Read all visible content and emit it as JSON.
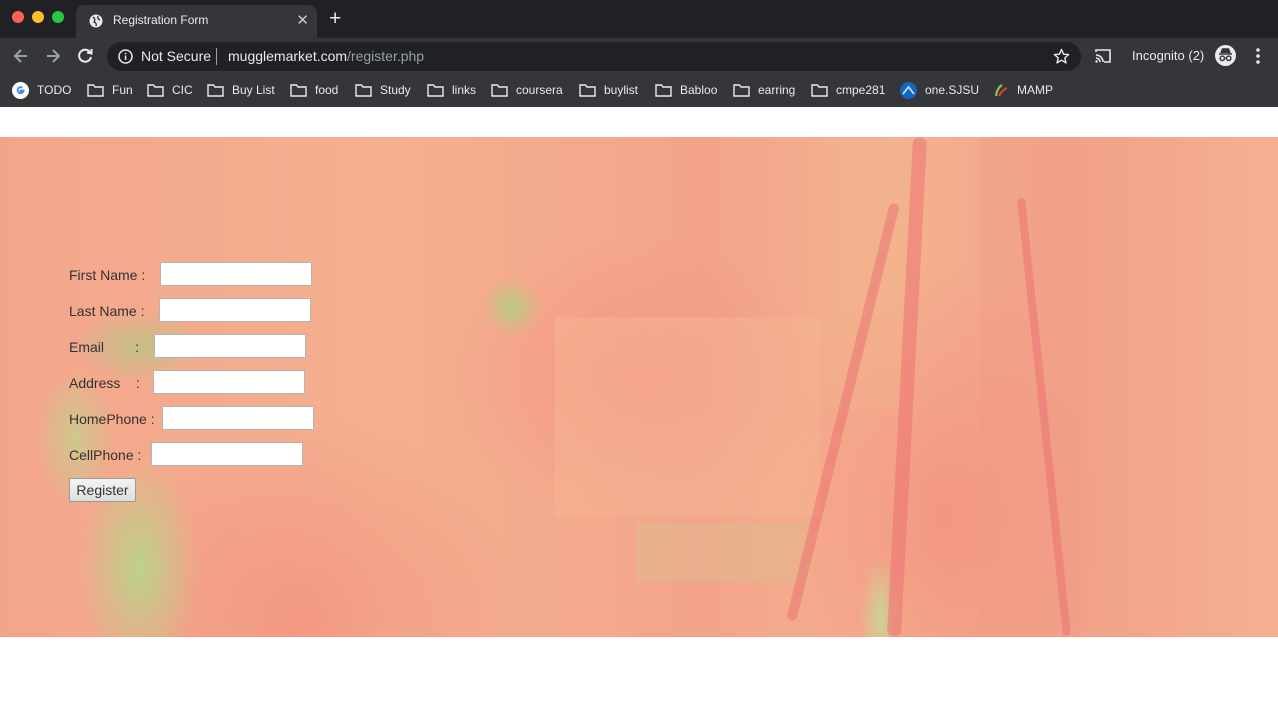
{
  "browser": {
    "tab_title": "Registration Form",
    "security_label": "Not Secure",
    "url_host": "mugglemarket.com",
    "url_path": "/register.php",
    "incognito_label": "Incognito (2)"
  },
  "bookmarks": [
    {
      "label": "TODO",
      "icon": "google-icon"
    },
    {
      "label": "Fun",
      "icon": "folder-icon"
    },
    {
      "label": "CIC",
      "icon": "folder-icon"
    },
    {
      "label": "Buy List",
      "icon": "folder-icon"
    },
    {
      "label": "food",
      "icon": "folder-icon"
    },
    {
      "label": "Study",
      "icon": "folder-icon"
    },
    {
      "label": "links",
      "icon": "folder-icon"
    },
    {
      "label": "coursera",
      "icon": "folder-icon"
    },
    {
      "label": "buylist",
      "icon": "folder-icon"
    },
    {
      "label": "Babloo",
      "icon": "folder-icon"
    },
    {
      "label": "earring",
      "icon": "folder-icon"
    },
    {
      "label": "cmpe281",
      "icon": "folder-icon"
    },
    {
      "label": "one.SJSU",
      "icon": "sjsu-icon"
    },
    {
      "label": "MAMP",
      "icon": "mamp-icon"
    }
  ],
  "form": {
    "fields": [
      {
        "label": "First Name :",
        "value": ""
      },
      {
        "label": "Last Name :",
        "value": ""
      },
      {
        "label": "Email        :",
        "value": ""
      },
      {
        "label": "Address    :",
        "value": ""
      },
      {
        "label": "HomePhone :",
        "value": ""
      },
      {
        "label": "CellPhone :",
        "value": ""
      }
    ],
    "submit_label": "Register"
  },
  "colors": {
    "chrome_dark": "#202124",
    "chrome_toolbar": "#35363a",
    "banner_base": "#f3a58c"
  }
}
